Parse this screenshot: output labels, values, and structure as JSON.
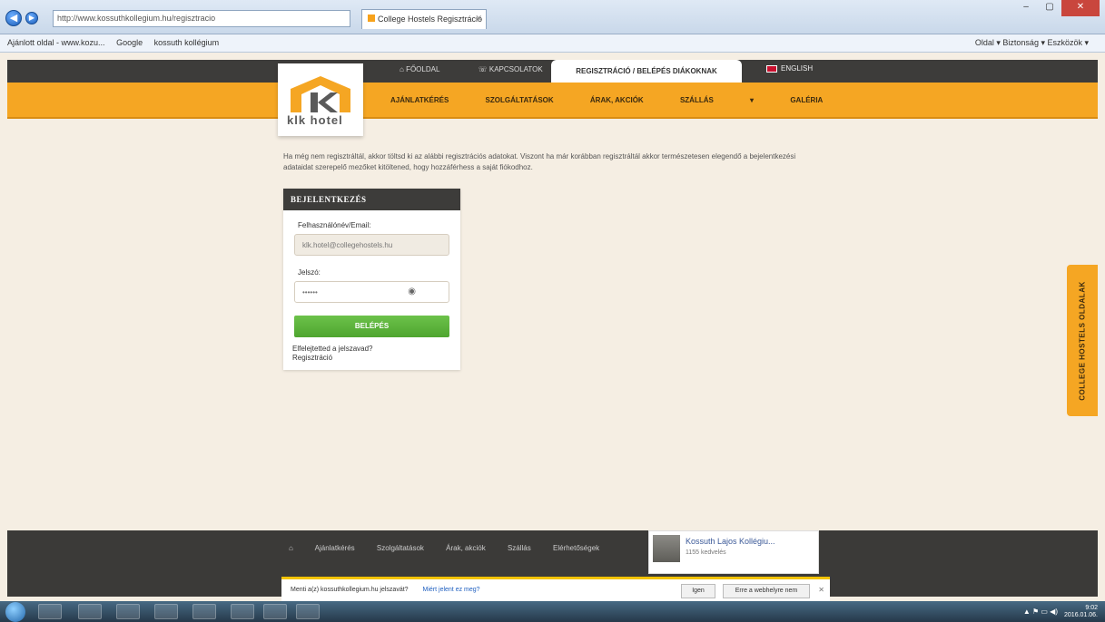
{
  "browser": {
    "address": "http://www.kossuthkollegium.hu/regisztracio",
    "tab_title": "College Hostels Regisztráció",
    "favorites": [
      "Ajánlott oldal - www.kozu...",
      "Google",
      "kossuth kollégium"
    ],
    "tools_right": "Oldal ▾  Biztonság ▾  Eszközök ▾"
  },
  "site": {
    "top_links": [
      "FŐOLDAL",
      "KAPCSOLATOK"
    ],
    "reg_tab": "REGISZTRÁCIÓ / BELÉPÉS DIÁKOKNAK",
    "english": "ENGLISH",
    "nav": [
      "AJÁNLATKÉRÉS",
      "SZOLGÁLTATÁSOK",
      "ÁRAK, AKCIÓK",
      "SZÁLLÁS",
      "GALÉRIA"
    ],
    "logo_text": "klk hotel",
    "intro": "Ha még nem regisztráltál, akkor töltsd ki az alábbi regisztrációs adatokat. Viszont ha már korábban regisztráltál akkor természetesen elegendő a bejelentkezési adataidat szerepelő mezőket kitöltened, hogy hozzáférhess a saját fiókodhoz.",
    "side_tab": "COLLEGE HOSTELS OLDALAK"
  },
  "login": {
    "title": "BEJELENTKEZÉS",
    "username_label": "Felhasználónév/Email:",
    "username_value": "klk.hotel@collegehostels.hu",
    "password_label": "Jelszó:",
    "password_value": "••••••",
    "submit": "BELÉPÉS",
    "forgot": "Elfelejtetted a jelszavad?",
    "register": "Regisztráció"
  },
  "footer": {
    "links": [
      "Ajánlatkérés",
      "Szolgáltatások",
      "Árak, akciók",
      "Szállás",
      "Elérhetőségek"
    ],
    "fb_name": "Kossuth Lajos Kollégiu...",
    "fb_likes": "1155 kedvelés"
  },
  "notification": {
    "text": "Menti a(z) kossuthkollegium.hu jelszavát?",
    "link": "Miért jelent ez meg?",
    "yes": "Igen",
    "no": "Erre a webhelyre nem"
  },
  "taskbar": {
    "time": "9:02",
    "date": "2016.01.06."
  },
  "colors": {
    "orange": "#f5a623",
    "dark": "#3d3c3a",
    "green": "#5ab53a"
  }
}
